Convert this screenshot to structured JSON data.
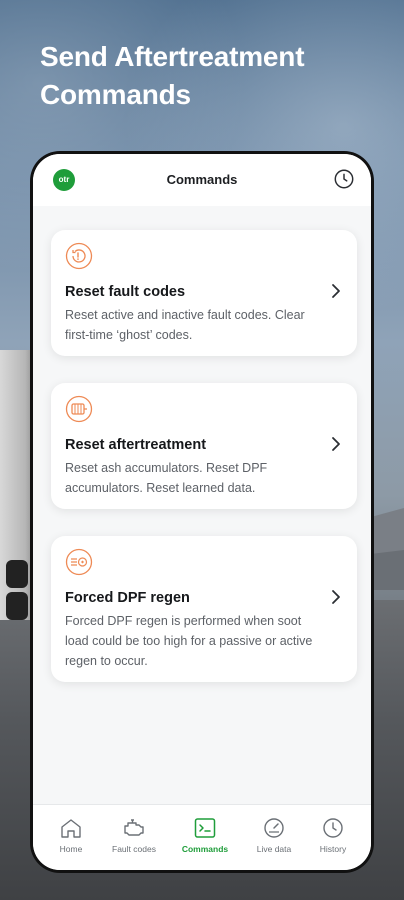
{
  "hero": {
    "title": "Send Aftertreatment Commands"
  },
  "app": {
    "logo_text": "otr",
    "header_title": "Commands",
    "header_icon": "history-clock-icon"
  },
  "commands": [
    {
      "icon": "reset-fault-codes-icon",
      "title": "Reset fault codes",
      "description": "Reset active and inactive fault codes. Clear first-time ‘ghost’ codes."
    },
    {
      "icon": "reset-aftertreatment-icon",
      "title": "Reset aftertreatment",
      "description": "Reset ash accumulators. Reset DPF accumulators. Reset learned data."
    },
    {
      "icon": "forced-dpf-regen-icon",
      "title": "Forced DPF regen",
      "description": "Forced DPF regen is performed when soot load could be too high for a passive or active regen to occur."
    }
  ],
  "tabs": [
    {
      "label": "Home",
      "icon": "home-icon",
      "active": false
    },
    {
      "label": "Fault codes",
      "icon": "engine-icon",
      "active": false
    },
    {
      "label": "Commands",
      "icon": "terminal-icon",
      "active": true
    },
    {
      "label": "Live data",
      "icon": "gauge-icon",
      "active": false
    },
    {
      "label": "History",
      "icon": "clock-icon",
      "active": false
    }
  ],
  "colors": {
    "accent": "#1f9d3a",
    "icon_orange": "#ee8a55",
    "text_primary": "#16181b",
    "text_secondary": "#5d6167"
  }
}
